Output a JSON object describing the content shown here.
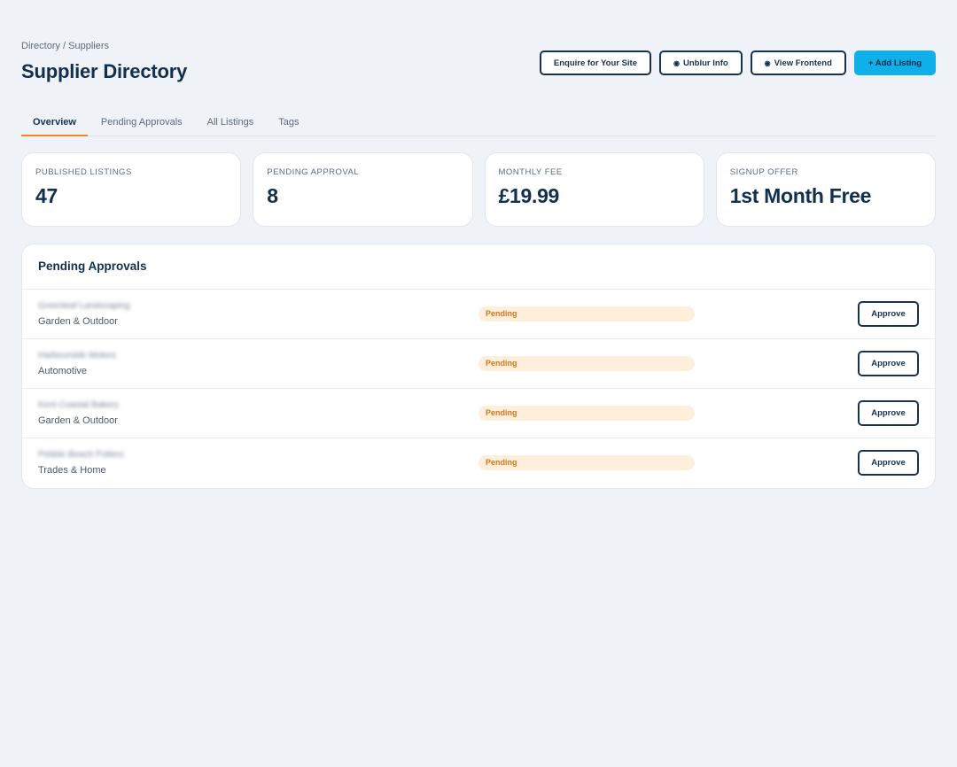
{
  "header": {
    "breadcrumb": "Directory / Suppliers",
    "title": "Supplier Directory",
    "actions": {
      "enquire": "Enquire for Your Site",
      "unblur": "Unblur Info",
      "view_frontend": "View Frontend",
      "add_listing": "+ Add Listing"
    },
    "icons": {
      "eye": "eye-icon"
    }
  },
  "tabs": [
    {
      "label": "Overview",
      "active": true
    },
    {
      "label": "Pending Approvals",
      "active": false
    },
    {
      "label": "All Listings",
      "active": false
    },
    {
      "label": "Tags",
      "active": false
    }
  ],
  "stats": [
    {
      "label": "PUBLISHED LISTINGS",
      "value": "47"
    },
    {
      "label": "PENDING APPROVAL",
      "value": "8"
    },
    {
      "label": "MONTHLY FEE",
      "value": "£19.99"
    },
    {
      "label": "SIGNUP OFFER",
      "value": "1st Month Free"
    }
  ],
  "pending": {
    "title": "Pending Approvals",
    "rows": [
      {
        "name": "Greenleaf Landscaping",
        "category": "Garden & Outdoor",
        "status": "Pending",
        "action": "Approve"
      },
      {
        "name": "Harbourside Motors",
        "category": "Automotive",
        "status": "Pending",
        "action": "Approve"
      },
      {
        "name": "Kent Coastal Bakery",
        "category": "Garden & Outdoor",
        "status": "Pending",
        "action": "Approve"
      },
      {
        "name": "Pebble Beach Potters",
        "category": "Trades & Home",
        "status": "Pending",
        "action": "Approve"
      }
    ]
  },
  "colors": {
    "accent": "#0fb0ea",
    "tab_underline": "#e98a2a",
    "pending_bg": "#fdefdc",
    "pending_text": "#d0771e",
    "navy": "#16324f"
  }
}
